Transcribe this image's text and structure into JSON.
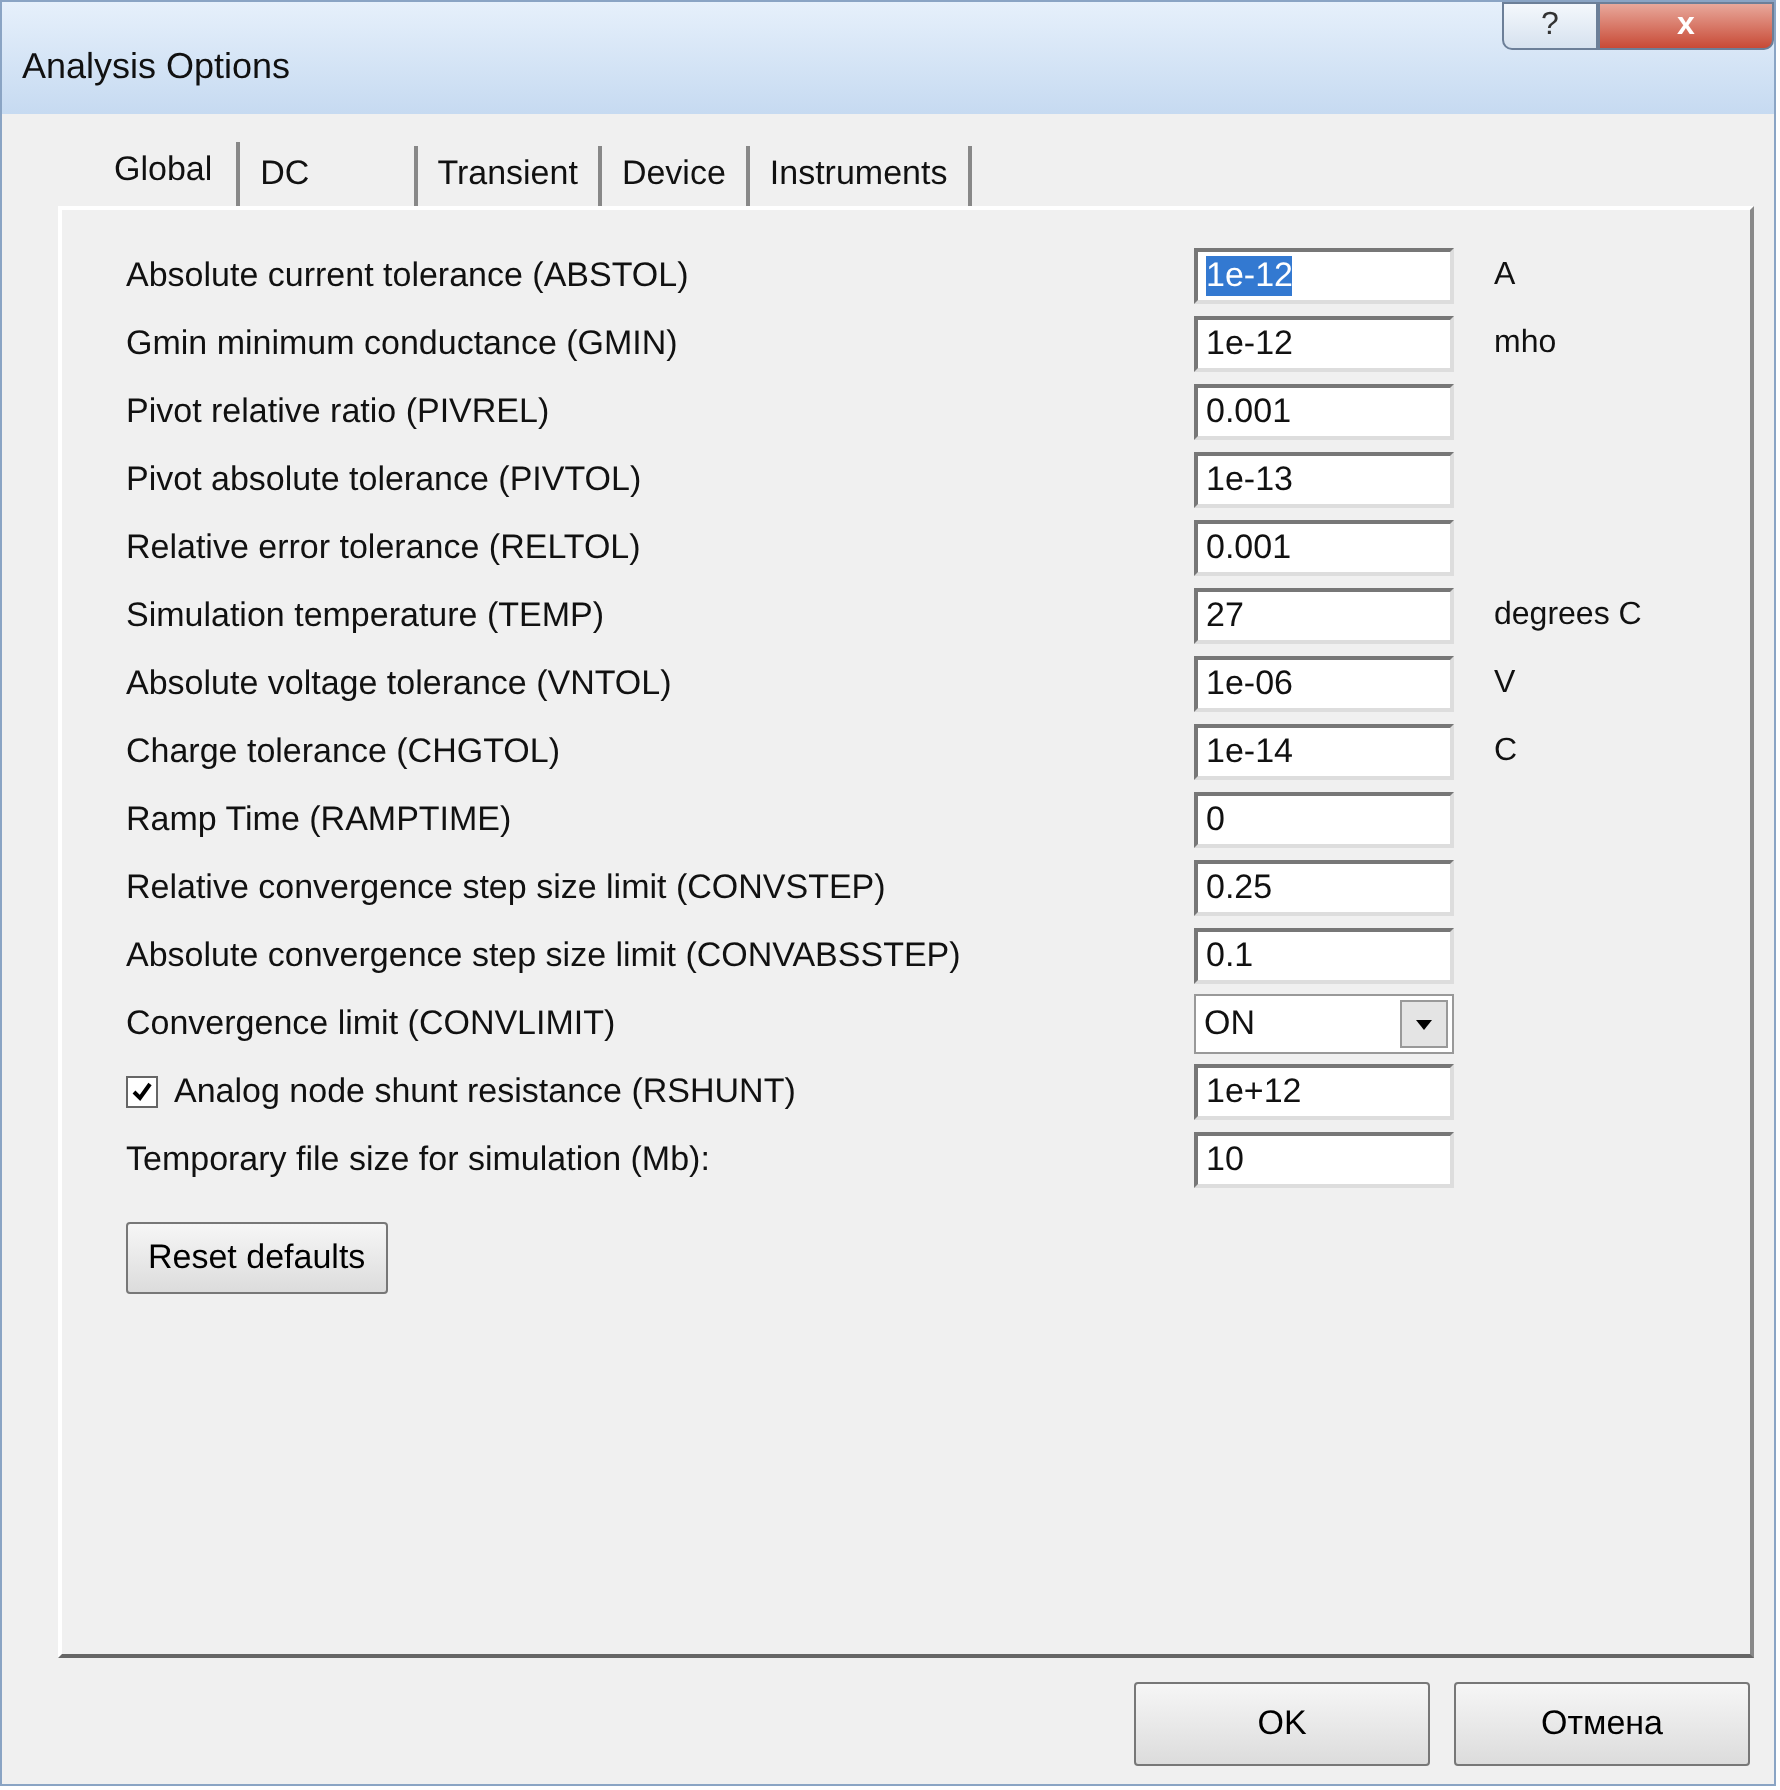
{
  "window": {
    "title": "Analysis Options",
    "buttons": [
      {
        "kind": "help",
        "label": "?"
      },
      {
        "kind": "close",
        "label": "x"
      }
    ]
  },
  "tabs": [
    {
      "label": "Global",
      "selected": true
    },
    {
      "label": "DC",
      "selected": false
    },
    {
      "label": "Transient",
      "selected": false
    },
    {
      "label": "Device",
      "selected": false
    },
    {
      "label": "Instruments",
      "selected": false
    }
  ],
  "options": [
    {
      "kind": "text",
      "label": "Absolute current tolerance (ABSTOL)",
      "value": "1e-12",
      "unit": "A",
      "selected": true
    },
    {
      "kind": "text",
      "label": "Gmin minimum conductance (GMIN)",
      "value": "1e-12",
      "unit": "mho",
      "selected": false
    },
    {
      "kind": "text",
      "label": "Pivot relative ratio (PIVREL)",
      "value": "0.001",
      "selected": false
    },
    {
      "kind": "text",
      "label": "Pivot absolute tolerance (PIVTOL)",
      "value": "1e-13",
      "selected": false
    },
    {
      "kind": "text",
      "label": "Relative error tolerance (RELTOL)",
      "value": "0.001",
      "selected": false
    },
    {
      "kind": "text",
      "label": "Simulation temperature (TEMP)",
      "value": "27",
      "unit": "degrees C",
      "selected": false
    },
    {
      "kind": "text",
      "label": "Absolute voltage tolerance (VNTOL)",
      "value": "1e-06",
      "unit": "V",
      "selected": false
    },
    {
      "kind": "text",
      "label": "Charge tolerance (CHGTOL)",
      "value": "1e-14",
      "unit": "C",
      "selected": false
    },
    {
      "kind": "text",
      "label": "Ramp Time (RAMPTIME)",
      "value": "0",
      "selected": false
    },
    {
      "kind": "text",
      "label": "Relative convergence step size limit (CONVSTEP)",
      "value": "0.25",
      "selected": false
    },
    {
      "kind": "text",
      "label": "Absolute convergence step size limit (CONVABSSTEP)",
      "value": "0.1",
      "selected": false
    },
    {
      "kind": "dropdown",
      "label": "Convergence limit (CONVLIMIT)",
      "value": "ON"
    },
    {
      "kind": "checkbox",
      "label": "Analog node shunt resistance (RSHUNT)",
      "value": "1e+12",
      "checked": true
    },
    {
      "kind": "text",
      "label": "Temporary file size for simulation (Mb):",
      "value": "10",
      "selected": false
    }
  ],
  "reset_button": "Reset defaults",
  "footer_buttons": [
    "OK",
    "Отмена"
  ]
}
